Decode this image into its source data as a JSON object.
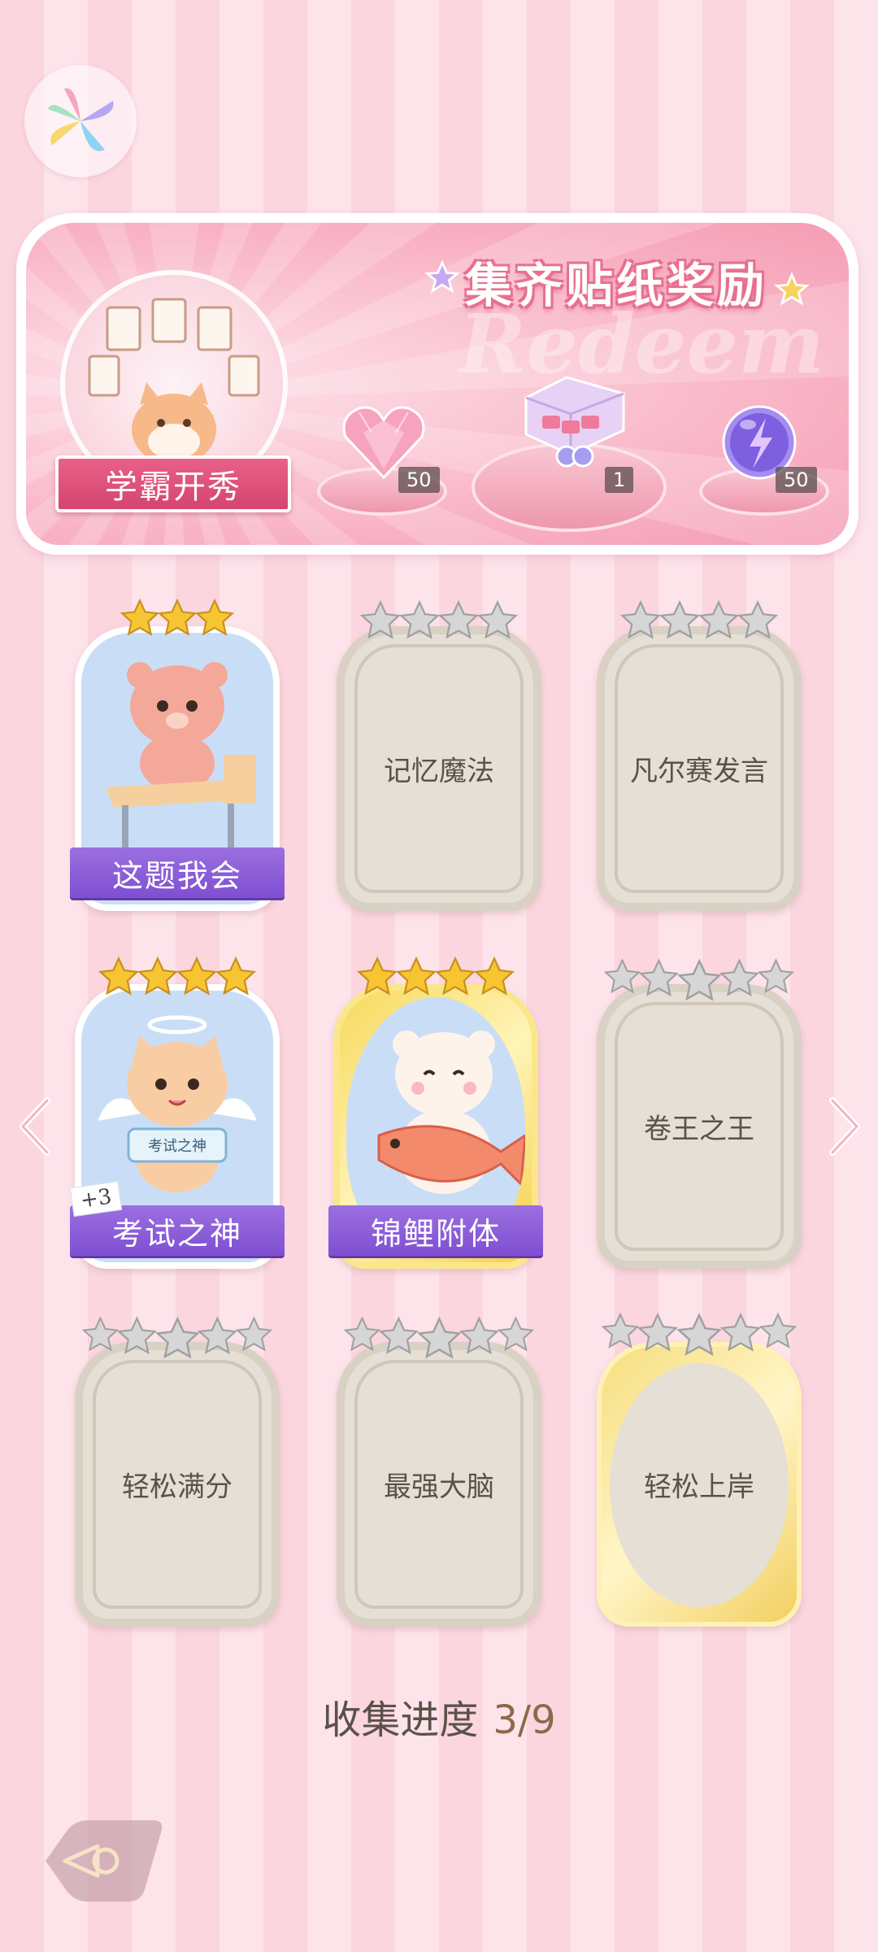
{
  "banner": {
    "title": "集齐贴纸奖励",
    "watermark": "Redeem",
    "badge_label": "学霸开秀",
    "rewards": [
      {
        "icon": "heart-gem-icon",
        "count": "50"
      },
      {
        "icon": "gift-box-icon",
        "count": "1"
      },
      {
        "icon": "energy-orb-icon",
        "count": "50"
      }
    ]
  },
  "cards": [
    {
      "label": "这题我会",
      "state": "unlocked",
      "stars_filled": 3,
      "stars_total": 3
    },
    {
      "label": "记忆魔法",
      "state": "locked",
      "stars_filled": 0,
      "stars_total": 4
    },
    {
      "label": "凡尔赛发言",
      "state": "locked",
      "stars_filled": 0,
      "stars_total": 4
    },
    {
      "label": "考试之神",
      "state": "unlocked",
      "stars_filled": 4,
      "stars_total": 4,
      "tag": "+3",
      "sign": "考试之神"
    },
    {
      "label": "锦鲤附体",
      "state": "unlocked-gold",
      "stars_filled": 4,
      "stars_total": 4
    },
    {
      "label": "卷王之王",
      "state": "locked",
      "stars_filled": 0,
      "stars_total": 5
    },
    {
      "label": "轻松满分",
      "state": "locked",
      "stars_filled": 0,
      "stars_total": 5
    },
    {
      "label": "最强大脑",
      "state": "locked",
      "stars_filled": 0,
      "stars_total": 5
    },
    {
      "label": "轻松上岸",
      "state": "locked-gold",
      "stars_filled": 0,
      "stars_total": 5
    }
  ],
  "progress": {
    "label": "收集进度",
    "value": "3/9"
  },
  "colors": {
    "ribbon_purple": "#8a5bd8",
    "banner_pink": "#f59cb4",
    "star_gold": "#f7c531",
    "star_silver": "#c9c9c9"
  }
}
